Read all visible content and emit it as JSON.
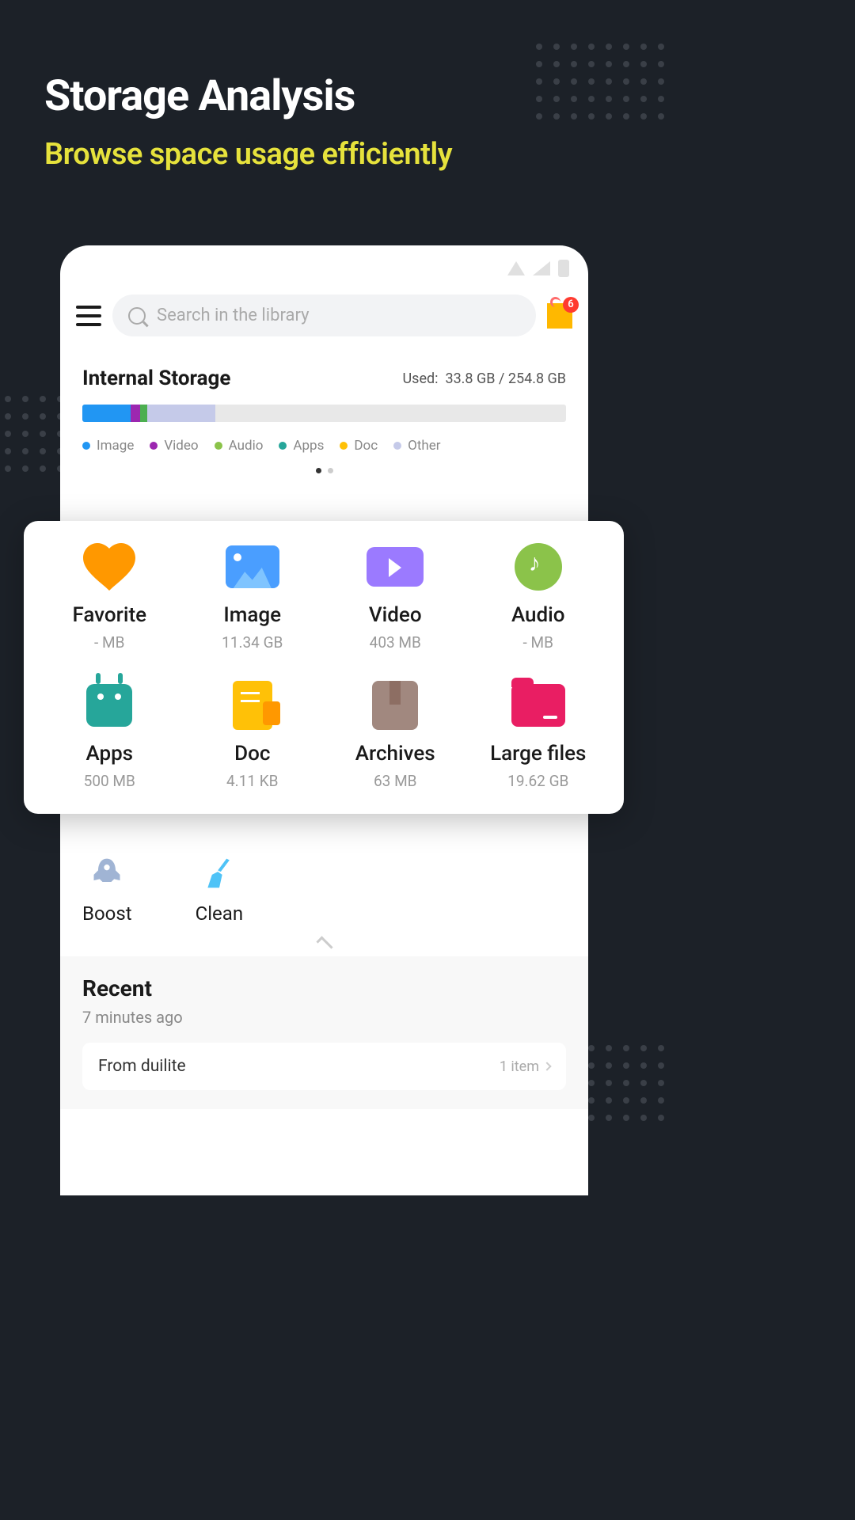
{
  "promo": {
    "title": "Storage Analysis",
    "subtitle": "Browse space usage efficiently"
  },
  "search": {
    "placeholder": "Search in the library"
  },
  "gift_badge": "6",
  "storage": {
    "title": "Internal Storage",
    "used_label": "Used:",
    "used_value": "33.8 GB / 254.8 GB",
    "segments": [
      {
        "color": "#2196f3",
        "width": "10%"
      },
      {
        "color": "#9c27b0",
        "width": "2%"
      },
      {
        "color": "#4caf50",
        "width": "1.5%"
      },
      {
        "color": "#c5cae9",
        "width": "14%"
      }
    ],
    "legend": [
      {
        "label": "Image",
        "color": "#2196f3"
      },
      {
        "label": "Video",
        "color": "#9c27b0"
      },
      {
        "label": "Audio",
        "color": "#8bc34a"
      },
      {
        "label": "Apps",
        "color": "#26a69a"
      },
      {
        "label": "Doc",
        "color": "#ffc107"
      },
      {
        "label": "Other",
        "color": "#c5cae9"
      }
    ]
  },
  "categories": [
    {
      "label": "Favorite",
      "size": "- MB"
    },
    {
      "label": "Image",
      "size": "11.34 GB"
    },
    {
      "label": "Video",
      "size": "403 MB"
    },
    {
      "label": "Audio",
      "size": "- MB"
    },
    {
      "label": "Apps",
      "size": "500 MB"
    },
    {
      "label": "Doc",
      "size": "4.11 KB"
    },
    {
      "label": "Archives",
      "size": "63 MB"
    },
    {
      "label": "Large files",
      "size": "19.62 GB"
    }
  ],
  "tools": [
    {
      "label": "Boost"
    },
    {
      "label": "Clean"
    }
  ],
  "recent": {
    "title": "Recent",
    "time": "7 minutes ago",
    "from": "From duilite",
    "count": "1 item"
  }
}
